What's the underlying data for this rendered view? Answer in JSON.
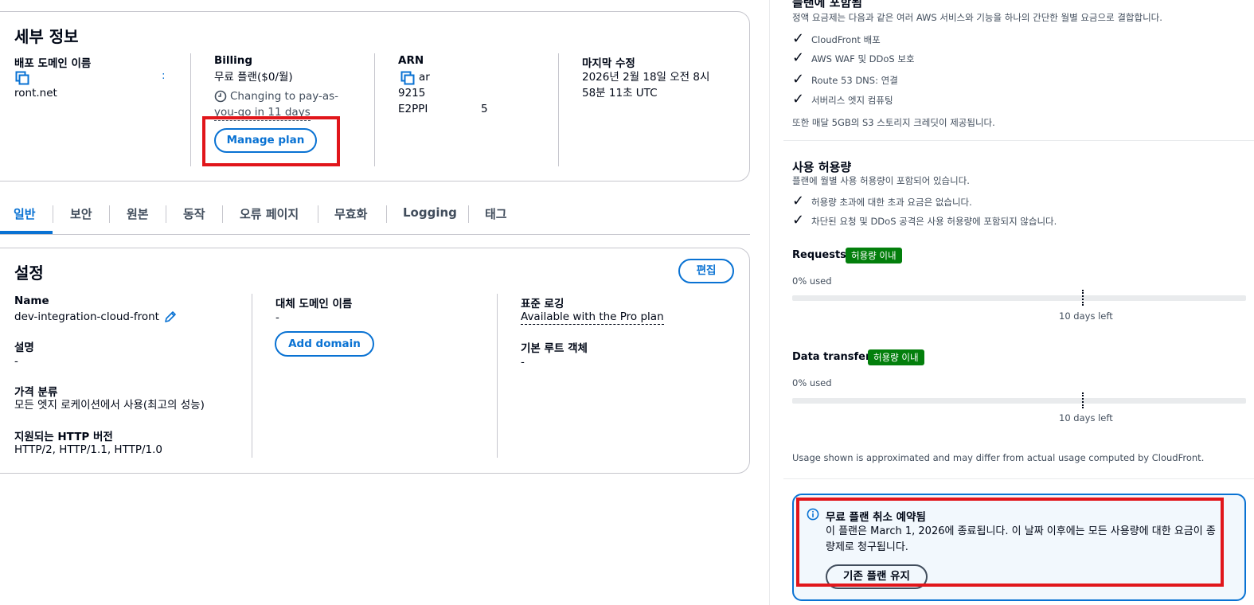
{
  "details": {
    "title": "세부 정보",
    "domain_label": "배포 도메인 이름",
    "domain_value": "ront.net",
    "domain_trail": ":",
    "billing_label": "Billing",
    "billing_value": "무료 플랜($0/월)",
    "billing_note_1": "Changing to pay-as-",
    "billing_note_2": "you-go in 11 days",
    "manage_plan": "Manage plan",
    "arn_label": "ARN",
    "arn_line1": "ar",
    "arn_line2": "9215",
    "arn_line3": "E2PPI",
    "arn_trail": "5",
    "modified_label": "마지막 수정",
    "modified_line1": "2026년 2월 18일 오전 8시",
    "modified_line2": "58분 11초 UTC"
  },
  "tabs": [
    "일반",
    "보안",
    "원본",
    "동작",
    "오류 페이지",
    "무효화",
    "Logging",
    "태그"
  ],
  "settings": {
    "title": "설정",
    "edit": "편집",
    "name_label": "Name",
    "name_value": "dev-integration-cloud-front",
    "desc_label": "설명",
    "desc_value": "-",
    "price_label": "가격 분류",
    "price_value": "모든 엣지 로케이션에서 사용(최고의 성능)",
    "http_label": "지원되는 HTTP 버전",
    "http_value": "HTTP/2, HTTP/1.1, HTTP/1.0",
    "alt_label": "대체 도메인 이름",
    "alt_value": "-",
    "add_domain": "Add domain",
    "log_label": "표준 로깅",
    "log_value": "Available with the Pro plan",
    "root_label": "기본 루트 객체",
    "root_value": "-"
  },
  "plan": {
    "title": "플랜에 포함됨",
    "subtitle": "정액 요금제는 다음과 같은 여러 AWS 서비스와 기능을 하나의 간단한 월별 요금으로 결합합니다.",
    "items": [
      "CloudFront 배포",
      "AWS WAF 및 DDoS 보호",
      "Route 53 DNS: 연결",
      "서버리스 엣지 컴퓨팅"
    ],
    "s3_note": "또한 매달 5GB의 S3 스토리지 크레딧이 제공됩니다."
  },
  "usage": {
    "title": "사용 허용량",
    "subtitle": "플랜에 월별 사용 허용량이 포함되어 있습니다.",
    "items": [
      "허용량 초과에 대한 초과 요금은 없습니다.",
      "차단된 요청 및 DDoS 공격은 사용 허용량에 포함되지 않습니다."
    ],
    "requests_label": "Requests",
    "requests_badge": "허용량 이내",
    "requests_used": "0% used",
    "requests_used_fraction": 0,
    "requests_left": "10 days left",
    "transfer_label": "Data transfer",
    "transfer_badge": "허용량 이내",
    "transfer_used": "0% used",
    "transfer_used_fraction": 0,
    "transfer_left": "10 days left",
    "footnote": "Usage shown is approximated and may differ from actual usage computed by CloudFront."
  },
  "alert": {
    "title": "무료 플랜 취소 예약됨",
    "line1": "이 플랜은 March 1, 2026에 종료됩니다. 이 날짜 이후에는 모든 사용량에 대한 요금이 종",
    "line2": "량제로 청구됩니다.",
    "button": "기존 플랜 유지"
  },
  "colors": {
    "accent": "#0972d3",
    "success": "#037f0c",
    "highlight": "#e1161b"
  }
}
